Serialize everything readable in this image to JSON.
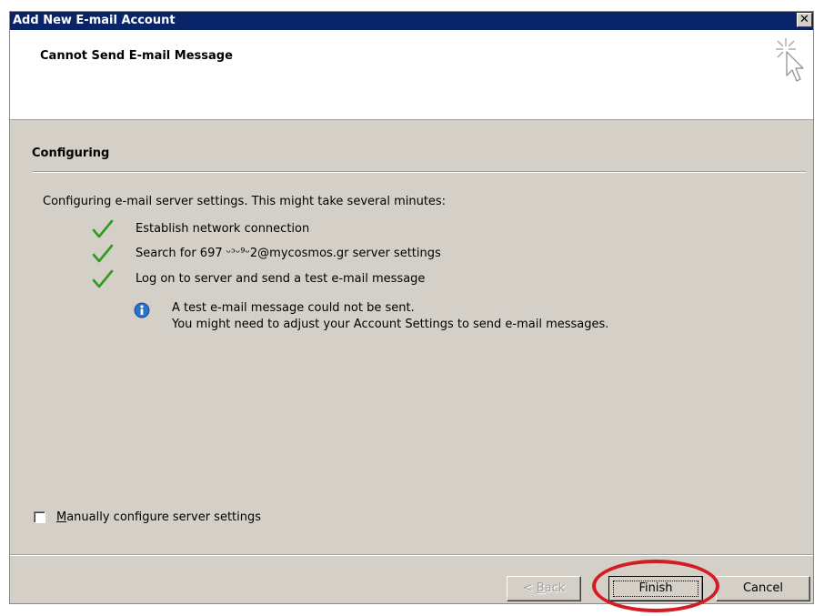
{
  "window": {
    "title": "Add New E-mail Account",
    "close_glyph": "✕"
  },
  "header": {
    "title": "Cannot Send E-mail Message",
    "icon": "sparkle-cursor-icon"
  },
  "section": {
    "title": "Configuring"
  },
  "intro_text": "Configuring e-mail server settings. This might take several minutes:",
  "steps": [
    {
      "label": "Establish network connection",
      "status": "done",
      "icon": "checkmark-icon"
    },
    {
      "label": "Search for 697  ᵕᵓᵕ⁹ᵕ2@mycosmos.gr server settings",
      "status": "done",
      "icon": "checkmark-icon"
    },
    {
      "label": "Log on to server and send a test e-mail message",
      "status": "done",
      "icon": "checkmark-icon"
    }
  ],
  "info": {
    "icon": "info-icon",
    "line1": "A test e-mail message could not be sent.",
    "line2": "You might need to adjust your Account Settings to send e-mail messages."
  },
  "manual_config": {
    "label_first": "M",
    "label_rest": "anually configure server settings",
    "checked": false
  },
  "buttons": {
    "back_prefix": "< ",
    "back_access": "B",
    "back_rest": "ack",
    "finish": "Finish",
    "cancel": "Cancel"
  },
  "colors": {
    "titlebar": "#0a246a",
    "checkmark": "#2e9b1e",
    "info": "#2a72c8",
    "annotation": "#d41c24"
  }
}
